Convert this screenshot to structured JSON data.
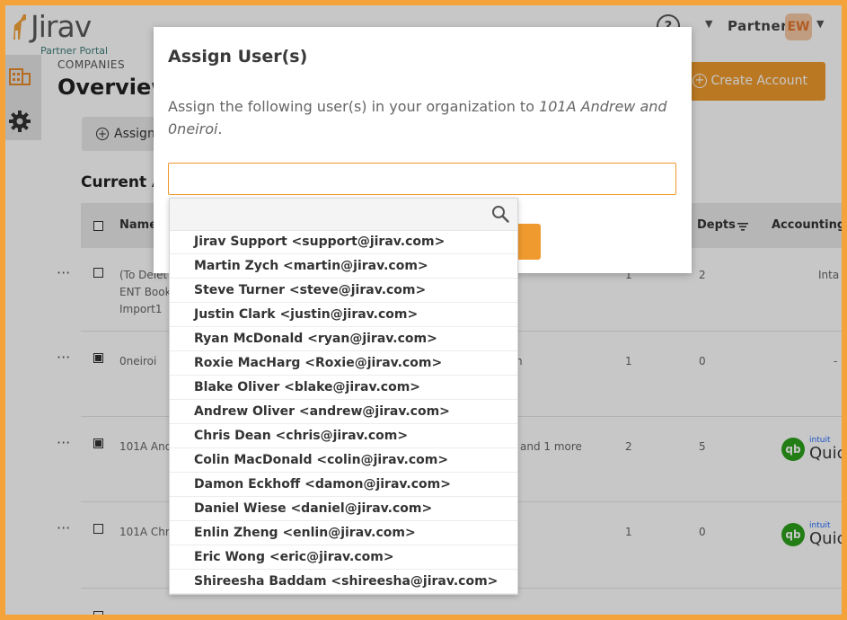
{
  "app": {
    "logo_text": "Jirav",
    "logo_subtitle": "Partner Portal"
  },
  "header": {
    "help_glyph": "?",
    "user_label": "Partner",
    "avatar_initials": "EW"
  },
  "page": {
    "breadcrumb": "COMPANIES",
    "title": "Overview",
    "create_button": "Create Account",
    "assign_button": "Assign",
    "section_title": "Current A"
  },
  "table": {
    "columns": {
      "name": "Name",
      "depts": "Depts",
      "accounting": "Accounting"
    },
    "rows": [
      {
        "name_lines": [
          "(To Delet",
          "ENT Book",
          "Import1"
        ],
        "checked": false,
        "col_a": "1",
        "depts": "2",
        "accounting": "Inta",
        "extra": ""
      },
      {
        "name_lines": [
          "0neiroi"
        ],
        "checked": true,
        "col_a": "1",
        "depts": "0",
        "accounting": "-",
        "extra": "n"
      },
      {
        "name_lines": [
          "101A And"
        ],
        "checked": true,
        "col_a": "2",
        "depts": "5",
        "accounting": "qb",
        "extra": "and 1 more"
      },
      {
        "name_lines": [
          "101A Chr"
        ],
        "checked": false,
        "col_a": "1",
        "depts": "0",
        "accounting": "qb",
        "extra": ""
      }
    ],
    "qb_brand": {
      "tag": "intuit",
      "word": "Quic",
      "glyph": "qb"
    }
  },
  "modal": {
    "title": "Assign User(s)",
    "description_prefix": "Assign the following user(s) in your organization to ",
    "description_target": "101A Andrew and 0neiroi",
    "description_suffix": ".",
    "input_value": "",
    "users": [
      "Jirav Support <support@jirav.com>",
      "Martin Zych <martin@jirav.com>",
      "Steve Turner <steve@jirav.com>",
      "Justin Clark <justin@jirav.com>",
      "Ryan McDonald <ryan@jirav.com>",
      "Roxie MacHarg <Roxie@jirav.com>",
      "Blake Oliver <blake@jirav.com>",
      "Andrew Oliver <andrew@jirav.com>",
      "Chris Dean <chris@jirav.com>",
      "Colin MacDonald <colin@jirav.com>",
      "Damon Eckhoff <damon@jirav.com>",
      "Daniel Wiese <daniel@jirav.com>",
      "Enlin Zheng <enlin@jirav.com>",
      "Eric Wong <eric@jirav.com>",
      "Shireesha Baddam <shireesha@jirav.com>"
    ]
  },
  "colors": {
    "accent": "#ef9a2e",
    "frame": "#f3a33a",
    "qb_green": "#2ca01c",
    "teal": "#3f7f7a"
  }
}
